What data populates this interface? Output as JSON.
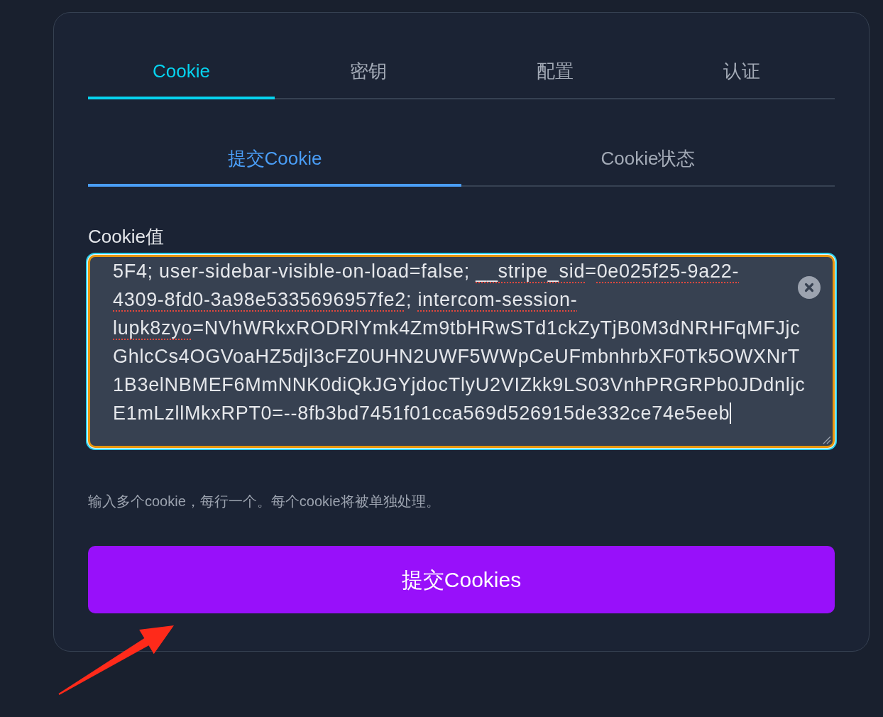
{
  "tabs": [
    {
      "label": "Cookie",
      "selected": true
    },
    {
      "label": "密钥",
      "selected": false
    },
    {
      "label": "配置",
      "selected": false
    },
    {
      "label": "认证",
      "selected": false
    }
  ],
  "subtabs": [
    {
      "label": "提交Cookie",
      "selected": true
    },
    {
      "label": "Cookie状态",
      "selected": false
    }
  ],
  "cookie_field": {
    "label": "Cookie值",
    "focused": true,
    "value_lines": [
      [
        {
          "text": "5F4; user-sidebar-visible-on-load=false; ",
          "flagged": false
        },
        {
          "text": "__stripe_sid",
          "flagged": true
        },
        {
          "text": "=",
          "flagged": false
        },
        {
          "text": "0e025f25-9a22-",
          "flagged": true
        }
      ],
      [
        {
          "text": "4309-8fd0-3a98e5335696957fe2",
          "flagged": true
        },
        {
          "text": "; ",
          "flagged": false
        },
        {
          "text": "intercom-session-",
          "flagged": true
        }
      ],
      [
        {
          "text": "lupk8zyo",
          "flagged": true
        },
        {
          "text": "=NVhWRkxRODRlYmk4Zm9tbHRwSTd1ckZyTjB0M3dNRHFqMFJjc",
          "flagged": false
        }
      ],
      [
        {
          "text": "GhlcCs4OGVoaHZ5djl3cFZ0UHN2UWF5WWpCeUFmbnhrbXF0Tk5OWXNrT",
          "flagged": false
        }
      ],
      [
        {
          "text": "1B3elNBMEF6MmNNK0diQkJGYjdocTlyU2VIZkk9LS03VnhPRGRPb0JDdnljc",
          "flagged": false
        }
      ],
      [
        {
          "text": "E1mLzllMkxRPT0=--8fb3bd7451f01cca569d526915de332ce74e5eeb",
          "flagged": false
        }
      ]
    ]
  },
  "hint": "输入多个cookie，每行一个。每个cookie将被单独处理。",
  "submit_button": {
    "label": "提交Cookies"
  }
}
